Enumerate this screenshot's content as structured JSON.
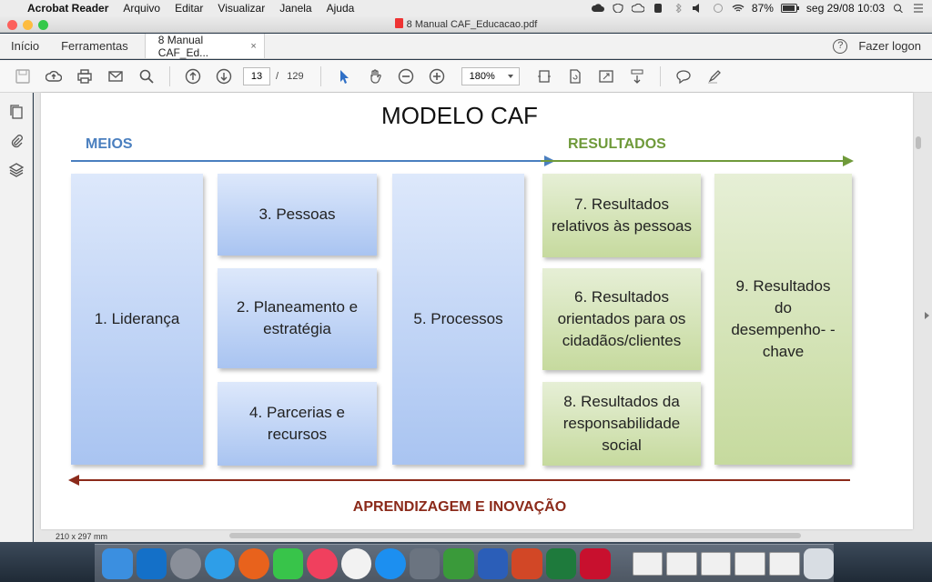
{
  "menubar": {
    "app_name": "Acrobat Reader",
    "menus": [
      "Arquivo",
      "Editar",
      "Visualizar",
      "Janela",
      "Ajuda"
    ],
    "battery": "87%",
    "datetime": "seg 29/08  10:03"
  },
  "window": {
    "title": "8 Manual CAF_Educacao.pdf"
  },
  "tabs": {
    "home": "Início",
    "tools": "Ferramentas",
    "document_tab": "8 Manual CAF_Ed...",
    "close": "×",
    "help": "?",
    "login": "Fazer logon"
  },
  "toolbar": {
    "current_page": "13",
    "page_separator": "/",
    "total_pages": "129",
    "zoom": "180%"
  },
  "document": {
    "page_size": "210 x 297 mm",
    "title": "MODELO CAF",
    "meios_label": "MEIOS",
    "resultados_label": "RESULTADOS",
    "aprendizagem_label": "APRENDIZAGEM E INOVAÇÃO",
    "boxes": {
      "lideranca": "1. Liderança",
      "pessoas": "3. Pessoas",
      "planeamento": "2. Planeamento e estratégia",
      "parcerias": "4. Parcerias e recursos",
      "processos": "5. Processos",
      "res_pessoas": "7. Resultados relativos às pessoas",
      "res_cidadaos": "6. Resultados orientados para os cidadãos/clientes",
      "res_social": "8. Resultados da responsabilidade social",
      "res_desempenho": "9. Resultados do desempenho- -chave"
    }
  },
  "colors": {
    "meios": "#4a7fbf",
    "resultados": "#6f9a3a",
    "aprendizagem": "#8b2a1a"
  }
}
